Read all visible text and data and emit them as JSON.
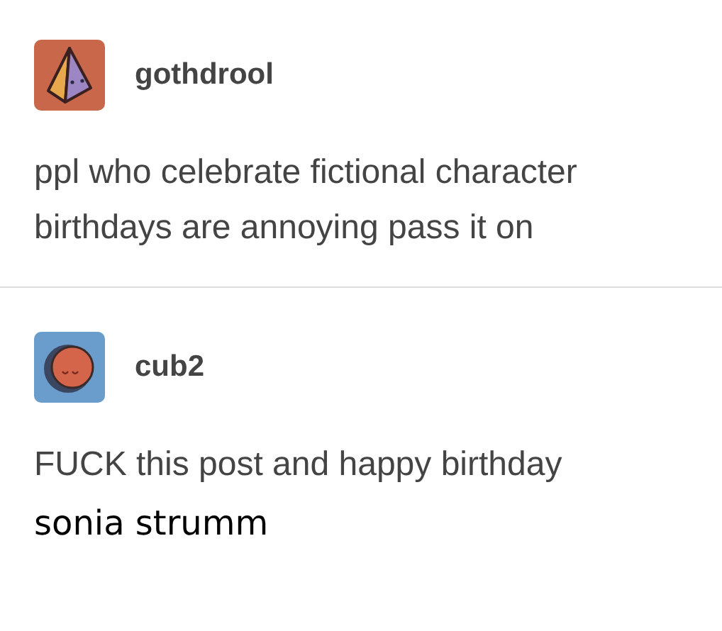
{
  "posts": [
    {
      "username": "gothdrool",
      "avatar": {
        "kind": "pyramid"
      },
      "text": "ppl who celebrate fictional character birthdays are annoying pass it on"
    },
    {
      "username": "cub2",
      "avatar": {
        "kind": "moon"
      },
      "text": "FUCK this post and happy birthday"
    }
  ],
  "caption": "sonia strumm"
}
